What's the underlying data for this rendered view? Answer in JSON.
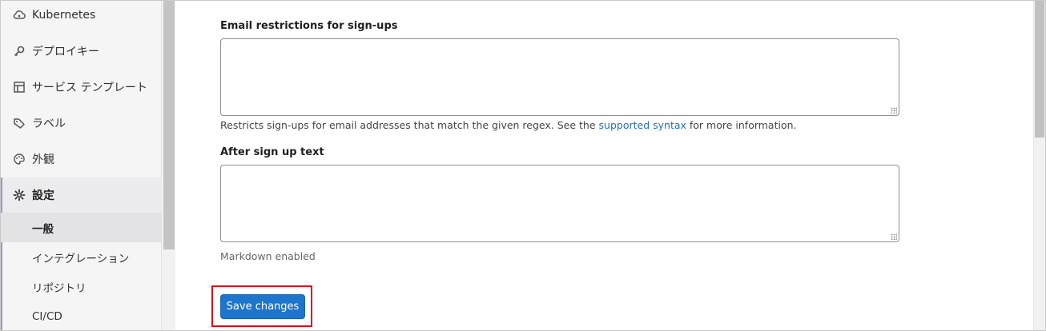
{
  "sidebar": {
    "items": [
      {
        "label": "Kubernetes",
        "icon": "cloud-gear-icon"
      },
      {
        "label": "デプロイキー",
        "icon": "key-icon"
      },
      {
        "label": "サービス テンプレート",
        "icon": "template-icon"
      },
      {
        "label": "ラベル",
        "icon": "label-tag-icon"
      },
      {
        "label": "外観",
        "icon": "palette-icon"
      },
      {
        "label": "設定",
        "icon": "gear-icon"
      }
    ],
    "subitems": [
      {
        "label": "一般"
      },
      {
        "label": "インテグレーション"
      },
      {
        "label": "リポジトリ"
      },
      {
        "label": "CI/CD"
      }
    ]
  },
  "form": {
    "email_restrictions_label": "Email restrictions for sign-ups",
    "email_restrictions_value": "",
    "email_help_prefix": "Restricts sign-ups for email addresses that match the given regex. See the ",
    "email_help_link": "supported syntax",
    "email_help_suffix": " for more information.",
    "after_signup_label": "After sign up text",
    "after_signup_value": "",
    "markdown_note": "Markdown enabled",
    "save_label": "Save changes"
  },
  "colors": {
    "primary_button": "#1f75cb",
    "link": "#1f6fc5",
    "highlight_box": "#e0001a"
  }
}
